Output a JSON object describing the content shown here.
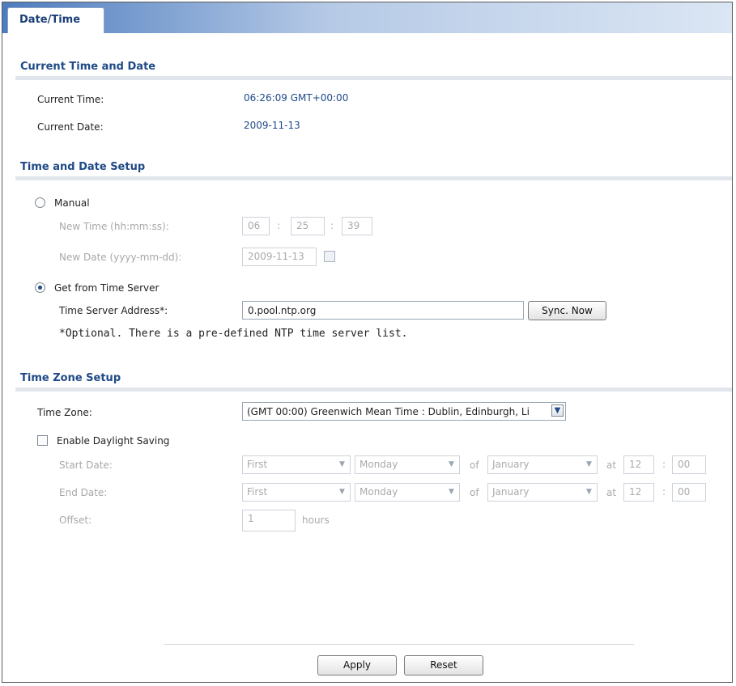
{
  "tab": {
    "label": "Date/Time"
  },
  "current": {
    "title": "Current Time and Date",
    "time_label": "Current Time:",
    "time_value": "06:26:09 GMT+00:00",
    "date_label": "Current Date:",
    "date_value": "2009-11-13"
  },
  "setup": {
    "title": "Time and Date Setup",
    "manual_label": "Manual",
    "new_time_label": "New Time (hh:mm:ss):",
    "new_time_hh": "06",
    "new_time_mm": "25",
    "new_time_ss": "39",
    "time_sep": ":",
    "new_date_label": "New Date (yyyy-mm-dd):",
    "new_date_value": "2009-11-13",
    "server_label": "Get from Time Server",
    "server_address_label": "Time Server Address*:",
    "server_address_value": "0.pool.ntp.org",
    "sync_button": "Sync. Now",
    "note": "*Optional. There is a pre-defined NTP time server list."
  },
  "timezone": {
    "title": "Time Zone Setup",
    "zone_label": "Time Zone:",
    "zone_value": "(GMT 00:00) Greenwich Mean Time : Dublin, Edinburgh, Li",
    "dst_label": "Enable Daylight Saving",
    "start_label": "Start Date:",
    "end_label": "End Date:",
    "offset_label": "Offset:",
    "ordinal": "First",
    "weekday": "Monday",
    "of": "of",
    "month": "January",
    "at": "at",
    "hour": "12",
    "minute": "00",
    "colon": ":",
    "offset_value": "1",
    "hours": "hours"
  },
  "footer": {
    "apply": "Apply",
    "reset": "Reset"
  }
}
